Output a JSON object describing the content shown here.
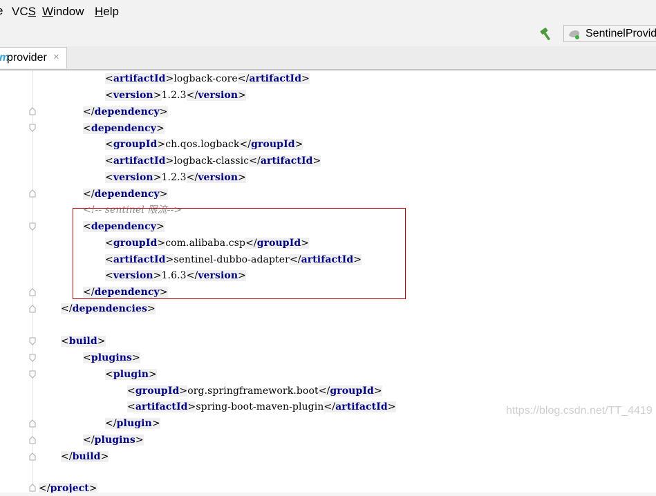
{
  "menubar": {
    "stub": "e",
    "items": [
      {
        "pre": "VC",
        "mn": "S",
        "post": ""
      },
      {
        "pre": "",
        "mn": "W",
        "post": "indow"
      },
      {
        "pre": "",
        "mn": "H",
        "post": "elp"
      }
    ]
  },
  "toolbar": {
    "build_icon": "hammer-icon",
    "run_config_label": "SentinelProvider",
    "run_config_icon": "spring-boot-icon"
  },
  "tab": {
    "label": "provider",
    "icon": "maven-m-icon",
    "close_glyph": "×"
  },
  "editor": {
    "comment": "<!-- sentinel 限流-->",
    "lines": {
      "l1_tag": "artifactId",
      "l1_text": "logback-core",
      "l2_tag": "version",
      "l2_text": "1.2.3",
      "l3_tag": "dependency",
      "l4_tag": "dependency",
      "l5_tag": "groupId",
      "l5_text": "ch.qos.logback",
      "l6_tag": "artifactId",
      "l6_text": "logback-classic",
      "l7_tag": "version",
      "l7_text": "1.2.3",
      "l8_tag": "dependency",
      "l10_tag": "dependency",
      "l11_tag": "groupId",
      "l11_text": "com.alibaba.csp",
      "l12_tag": "artifactId",
      "l12_text": "sentinel-dubbo-adapter",
      "l13_tag": "version",
      "l13_text": "1.6.3",
      "l14_tag": "dependency",
      "l15_tag": "dependencies",
      "l17_tag": "build",
      "l18_tag": "plugins",
      "l19_tag": "plugin",
      "l20_tag": "groupId",
      "l20_text": "org.springframework.boot",
      "l21_tag": "artifactId",
      "l21_text": "spring-boot-maven-plugin",
      "l22_tag": "plugin",
      "l23_tag": "plugins",
      "l24_tag": "build",
      "l26_tag": "project"
    },
    "watermark": "https://blog.csdn.net/TT_4419"
  }
}
